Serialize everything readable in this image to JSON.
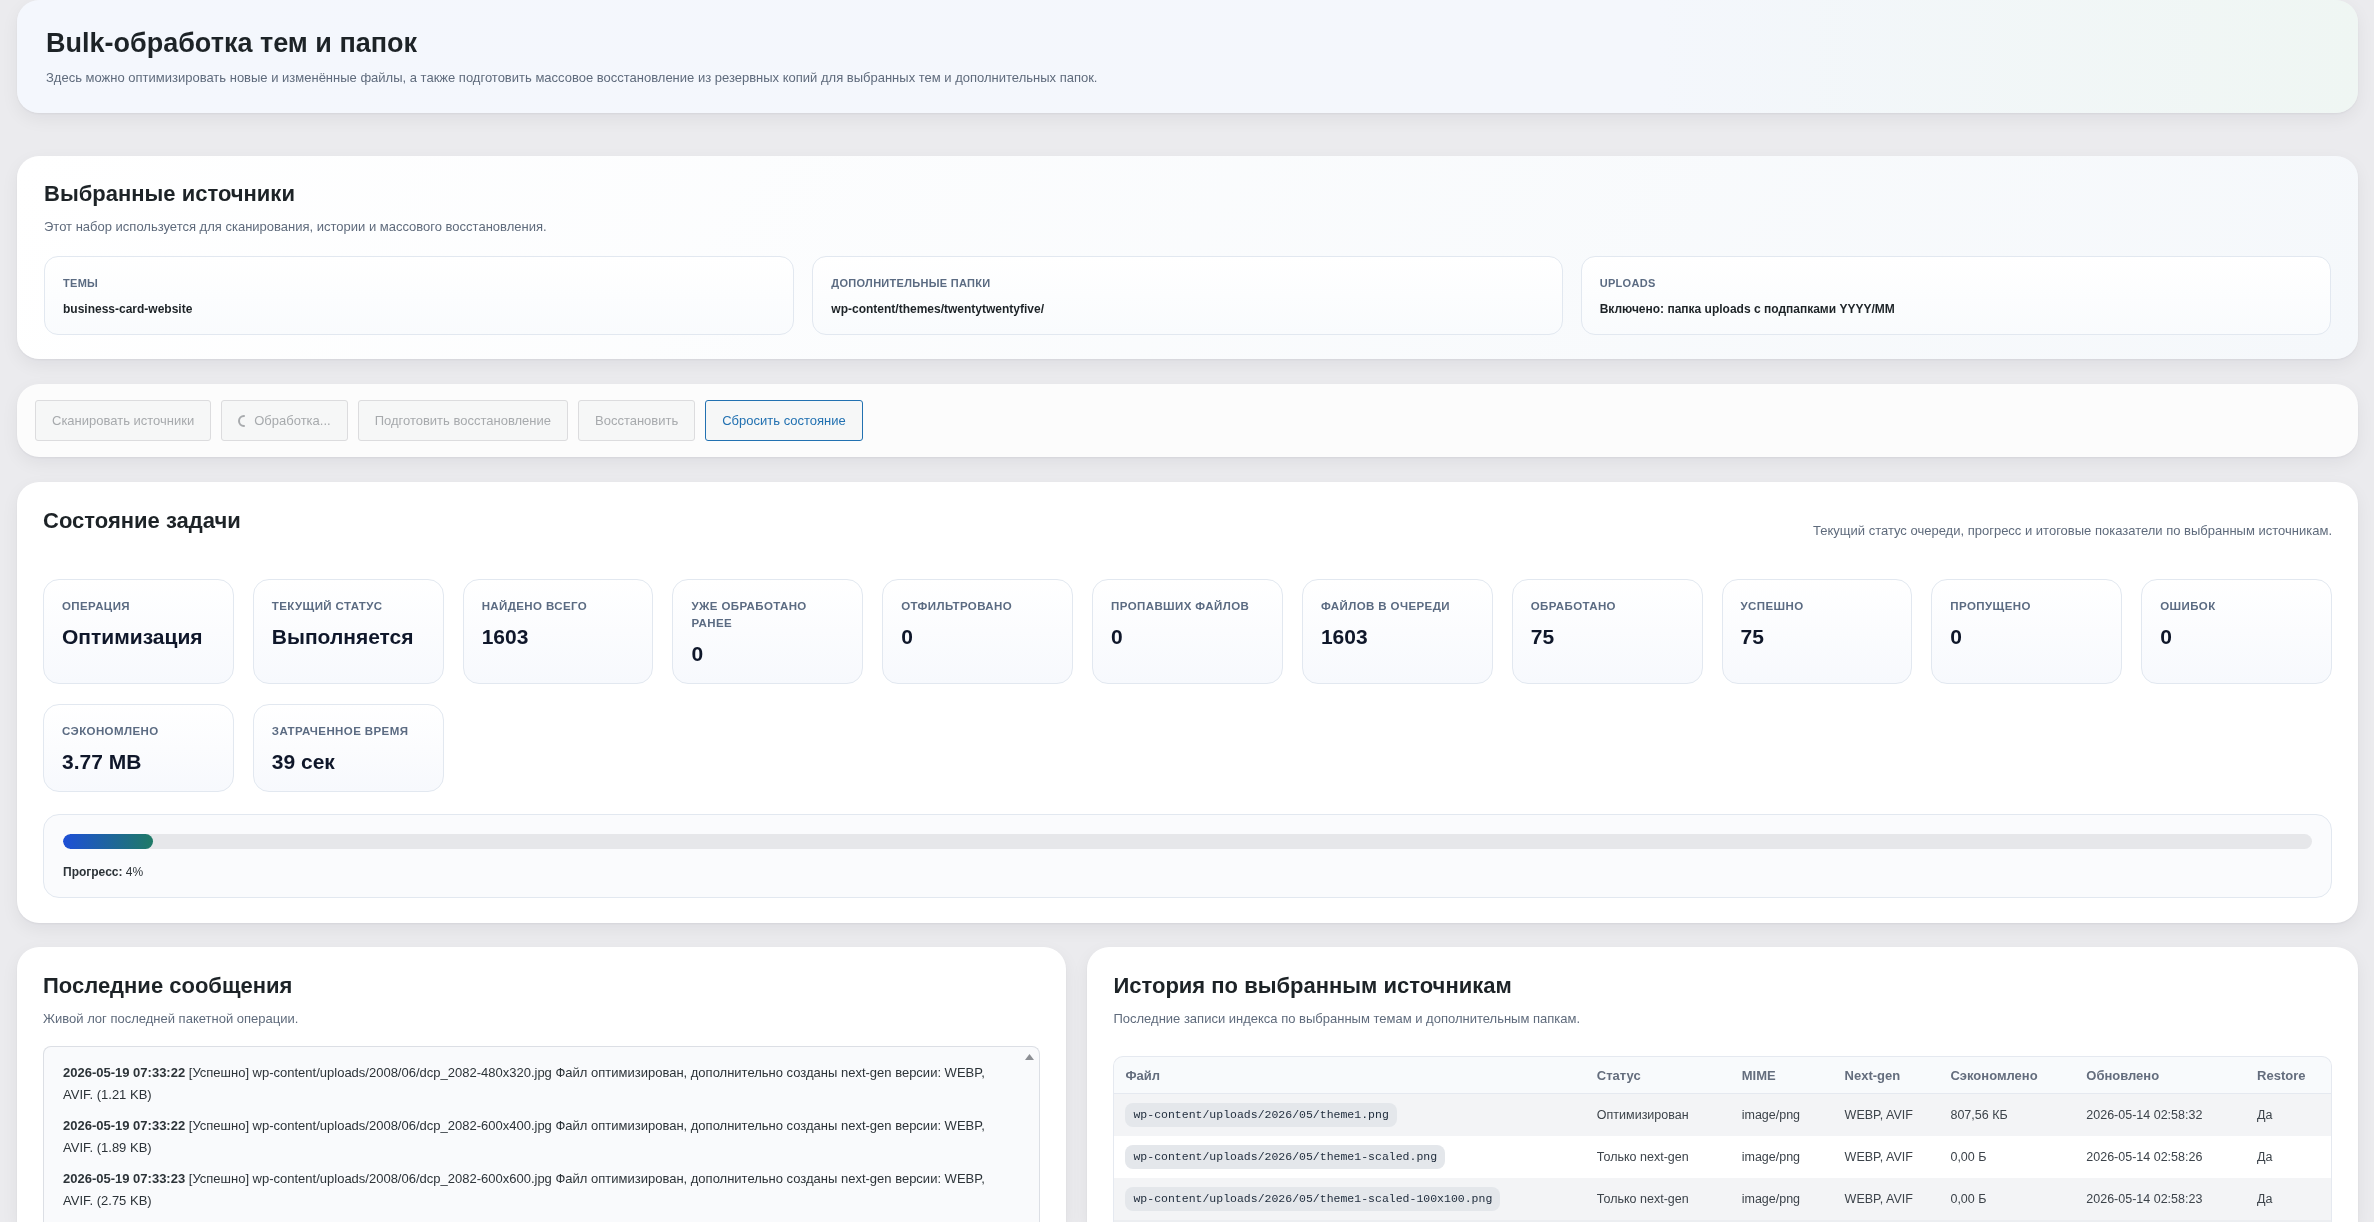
{
  "header": {
    "title": "Bulk-обработка тем и папок",
    "description": "Здесь можно оптимизировать новые и изменённые файлы, а также подготовить массовое восстановление из резервных копий для выбранных тем и дополнительных папок."
  },
  "sources": {
    "title": "Выбранные источники",
    "description": "Этот набор используется для сканирования, истории и массового восстановления.",
    "items": [
      {
        "label": "ТЕМЫ",
        "value": "business-card-website"
      },
      {
        "label": "ДОПОЛНИТЕЛЬНЫЕ ПАПКИ",
        "value": "wp-content/themes/twentytwentyfive/"
      },
      {
        "label": "UPLOADS",
        "value": "Включено: папка uploads с подпапками YYYY/MM"
      }
    ]
  },
  "actions": [
    {
      "label": "Сканировать источники",
      "disabled": true,
      "busy": false
    },
    {
      "label": "Обработка...",
      "disabled": true,
      "busy": true
    },
    {
      "label": "Подготовить восстановление",
      "disabled": true,
      "busy": false
    },
    {
      "label": "Восстановить",
      "disabled": true,
      "busy": false
    },
    {
      "label": "Сбросить состояние",
      "disabled": false,
      "busy": false
    }
  ],
  "job_status": {
    "title": "Состояние задачи",
    "description": "Текущий статус очереди, прогресс и итоговые показатели по выбранным источникам.",
    "stats": [
      {
        "label": "ОПЕРАЦИЯ",
        "value": "Оптимизация"
      },
      {
        "label": "ТЕКУЩИЙ СТАТУС",
        "value": "Выполняется"
      },
      {
        "label": "НАЙДЕНО ВСЕГО",
        "value": "1603"
      },
      {
        "label": "УЖЕ ОБРАБОТАНО РАНЕЕ",
        "value": "0"
      },
      {
        "label": "ОТФИЛЬТРОВАНО",
        "value": "0"
      },
      {
        "label": "ПРОПАВШИХ ФАЙЛОВ",
        "value": "0"
      },
      {
        "label": "ФАЙЛОВ В ОЧЕРЕДИ",
        "value": "1603"
      },
      {
        "label": "ОБРАБОТАНО",
        "value": "75"
      },
      {
        "label": "УСПЕШНО",
        "value": "75"
      },
      {
        "label": "ПРОПУЩЕНО",
        "value": "0"
      },
      {
        "label": "ОШИБОК",
        "value": "0"
      },
      {
        "label": "СЭКОНОМЛЕНО",
        "value": "3.77 MB"
      },
      {
        "label": "ЗАТРАЧЕННОЕ ВРЕМЯ",
        "value": "39 сек"
      }
    ],
    "progress": {
      "level": 0.04,
      "label": "**Прогресс:** 4%"
    }
  },
  "messages": {
    "title": "Последние сообщения",
    "description": "Живой лог последней пакетной операции.",
    "entries": [
      "**2026-05-19 07:33:22** [Успешно] wp-content/uploads/2008/06/dcp_2082-480x320.jpg Файл оптимизирован, дополнительно созданы next-gen версии: WEBP, AVIF. (1.21 KB)",
      "**2026-05-19 07:33:22** [Успешно] wp-content/uploads/2008/06/dcp_2082-600x400.jpg Файл оптимизирован, дополнительно созданы next-gen версии: WEBP, AVIF. (1.89 KB)",
      "**2026-05-19 07:33:23** [Успешно] wp-content/uploads/2008/06/dcp_2082-600x600.jpg Файл оптимизирован, дополнительно созданы next-gen версии: WEBP, AVIF. (2.75 KB)"
    ]
  },
  "history": {
    "title": "История по выбранным источникам",
    "description": "Последние записи индекса по выбранным темам и дополнительным папкам.",
    "columns": [
      "Файл",
      "Статус",
      "MIME",
      "Next-gen",
      "Сэкономлено",
      "Обновлено",
      "Restore"
    ],
    "rows": [
      {
        "file": "wp-content/uploads/2026/05/theme1.png",
        "status": "Оптимизирован",
        "mime": "image/png",
        "next_gen": "WEBP, AVIF",
        "saved": "807,56 КБ",
        "updated": "2026-05-14 02:58:32",
        "restore": "Да"
      },
      {
        "file": "wp-content/uploads/2026/05/theme1-scaled.png",
        "status": "Только next-gen",
        "mime": "image/png",
        "next_gen": "WEBP, AVIF",
        "saved": "0,00 Б",
        "updated": "2026-05-14 02:58:26",
        "restore": "Да"
      },
      {
        "file": "wp-content/uploads/2026/05/theme1-scaled-100x100.png",
        "status": "Только next-gen",
        "mime": "image/png",
        "next_gen": "WEBP, AVIF",
        "saved": "0,00 Б",
        "updated": "2026-05-14 02:58:23",
        "restore": "Да"
      }
    ]
  }
}
